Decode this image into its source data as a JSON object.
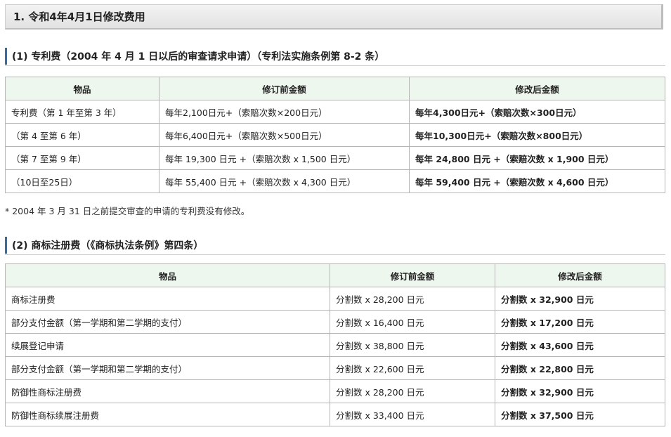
{
  "page_title": "1. 令和4年4月1日修改费用",
  "section1": {
    "heading": "(1) 专利费（2004 年 4 月 1 日以后的审查请求申请）（专利法实施条例第 8-2 条）",
    "headers": [
      "物品",
      "修订前金额",
      "修改后金额"
    ],
    "rows": [
      [
        "专利费（第 1 年至第 3 年）",
        "每年2,100日元+（索赔次数×200日元）",
        "每年4,300日元+（索赔次数×300日元）"
      ],
      [
        "（第 4 至第 6 年）",
        "每年6,400日元+（索赔次数×500日元）",
        "每年10,300日元+（索赔次数×800日元）"
      ],
      [
        "（第 7 至第 9 年）",
        "每年 19,300 日元 +（索赔次数 x 1,500 日元）",
        "每年 24,800 日元 +（索赔次数 x 1,900 日元）"
      ],
      [
        "（10日至25日）",
        "每年 55,400 日元 +（索赔次数 x 4,300 日元）",
        "每年 59,400 日元 +（索赔次数 x 4,600 日元）"
      ]
    ],
    "note": "* 2004 年 3 月 31 日之前提交审查的申请的专利费没有修改。"
  },
  "section2": {
    "heading": "(2) 商标注册费（《商标执法条例》第四条）",
    "headers": [
      "物品",
      "修订前金额",
      "修改后金额"
    ],
    "rows": [
      [
        "商标注册费",
        "分割数 x 28,200 日元",
        "分割数 x 32,900 日元"
      ],
      [
        "部分支付金额（第一学期和第二学期的支付）",
        "分割数 x 16,400 日元",
        "分割数 x 17,200 日元"
      ],
      [
        "续展登记申请",
        "分割数 x 38,800 日元",
        "分割数 x 43,600 日元"
      ],
      [
        "部分支付金额（第一学期和第二学期的支付）",
        "分割数 x 22,600 日元",
        "分割数 x 22,800 日元"
      ],
      [
        "防御性商标注册费",
        "分割数 x 28,200 日元",
        "分割数 x 32,900 日元"
      ],
      [
        "防御性商标续展注册费",
        "分割数 x 33,400 日元",
        "分割数 x 37,500 日元"
      ]
    ]
  },
  "colors": {
    "header_bg": "#eef7ee",
    "section_bar": "#2d6fad",
    "border": "#b5b5b5"
  }
}
